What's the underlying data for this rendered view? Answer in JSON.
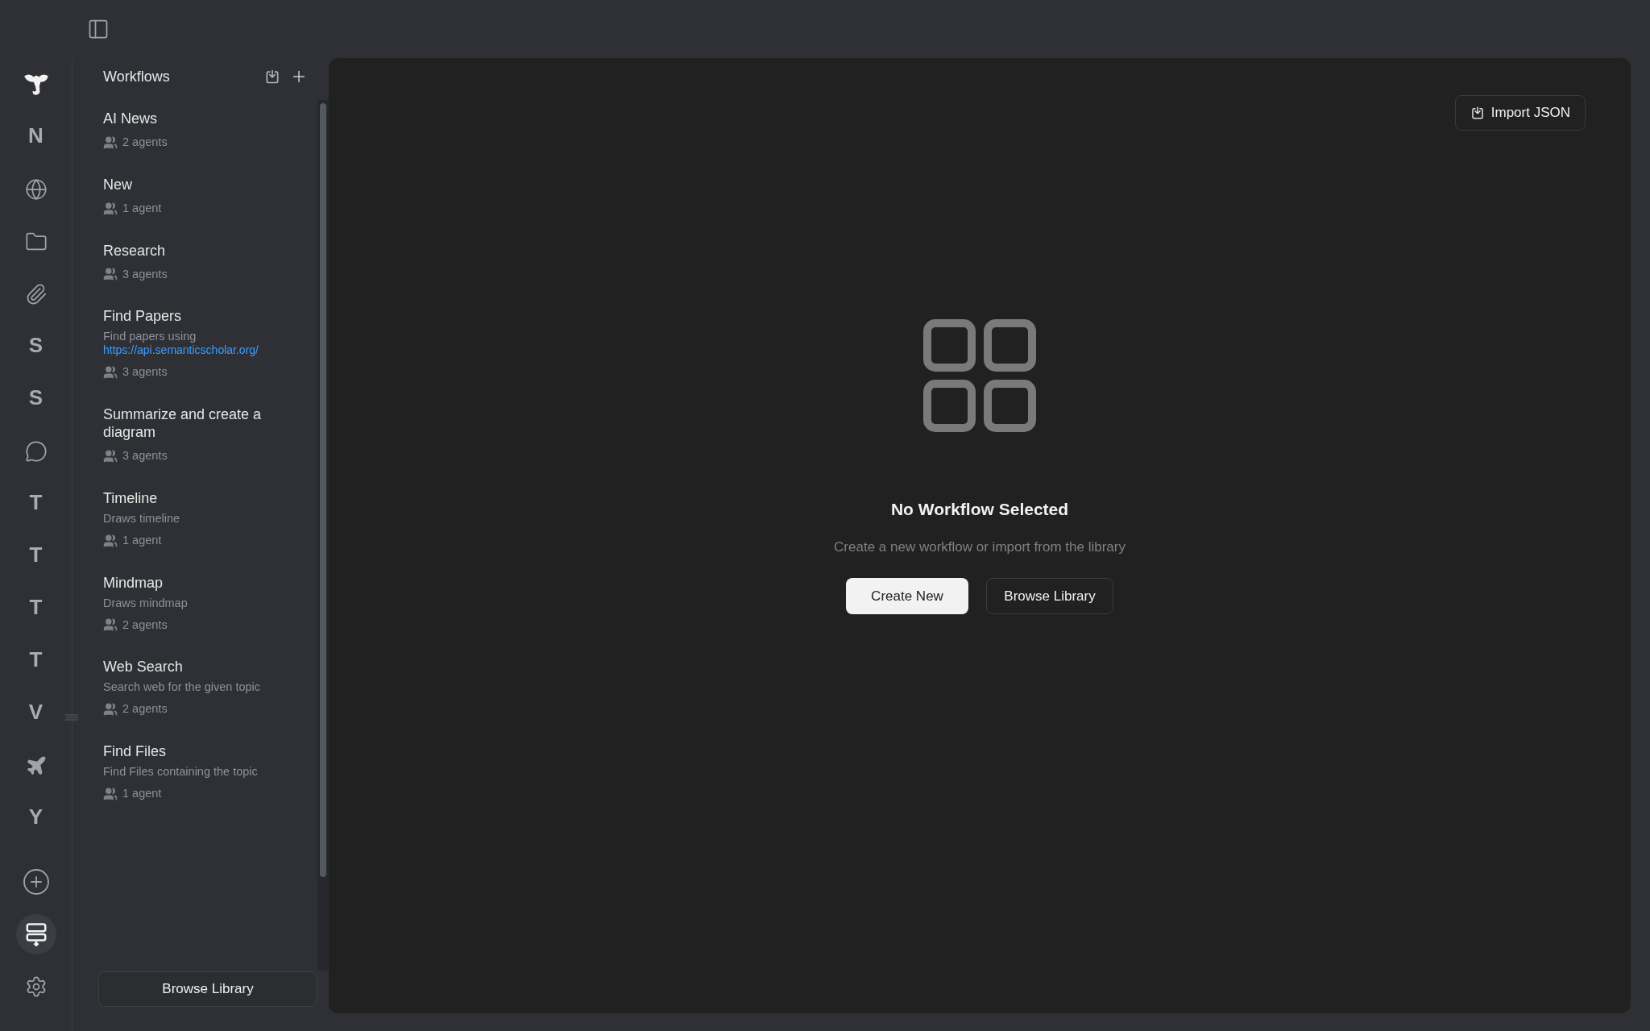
{
  "rail": [
    {
      "kind": "logo",
      "selected": false
    },
    {
      "kind": "letter",
      "text": "N",
      "selected": false
    },
    {
      "kind": "globe",
      "selected": false
    },
    {
      "kind": "folder",
      "selected": false
    },
    {
      "kind": "clip",
      "selected": false
    },
    {
      "kind": "letter",
      "text": "S",
      "selected": false
    },
    {
      "kind": "letter",
      "text": "S",
      "selected": false
    },
    {
      "kind": "chat",
      "selected": false
    },
    {
      "kind": "letter",
      "text": "T",
      "selected": false
    },
    {
      "kind": "letter",
      "text": "T",
      "selected": false
    },
    {
      "kind": "letter",
      "text": "T",
      "selected": false
    },
    {
      "kind": "letter",
      "text": "T",
      "selected": false
    },
    {
      "kind": "letter",
      "text": "V",
      "selected": false
    },
    {
      "kind": "plane",
      "selected": false
    },
    {
      "kind": "letter",
      "text": "Y",
      "selected": false
    },
    {
      "kind": "add",
      "selected": false
    },
    {
      "kind": "workflows",
      "selected": true
    },
    {
      "kind": "settings",
      "selected": false
    }
  ],
  "sidebar": {
    "title": "Workflows",
    "items": [
      {
        "title": "AI News",
        "agents": "2 agents"
      },
      {
        "title": "New",
        "agents": "1 agent"
      },
      {
        "title": "Research",
        "agents": "3 agents"
      },
      {
        "title": "Find Papers",
        "description": "Find papers using",
        "link": "https://api.semanticscholar.org/",
        "agents": "3 agents"
      },
      {
        "title": "Summarize and create a diagram",
        "agents": "3 agents"
      },
      {
        "title": "Timeline",
        "description": "Draws timeline",
        "agents": "1 agent"
      },
      {
        "title": "Mindmap",
        "description": "Draws mindmap",
        "agents": "2 agents"
      },
      {
        "title": "Web Search",
        "description": "Search web for the given topic",
        "agents": "2 agents"
      },
      {
        "title": "Find Files",
        "description": "Find Files containing the topic",
        "agents": "1 agent"
      }
    ],
    "footer_button": "Browse Library"
  },
  "main": {
    "import_button": "Import JSON",
    "empty_title": "No Workflow Selected",
    "empty_subtitle": "Create a new workflow or import from the library",
    "primary_button": "Create New",
    "secondary_button": "Browse Library"
  }
}
